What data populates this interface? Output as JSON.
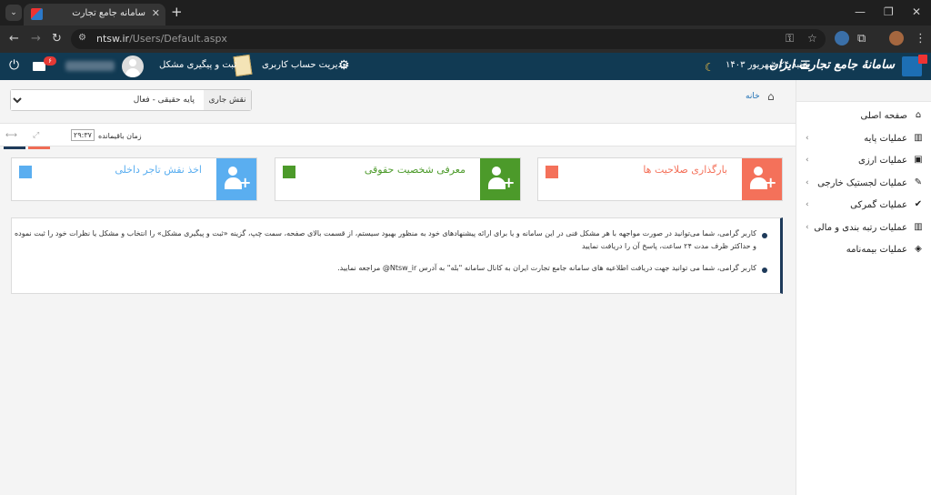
{
  "browser": {
    "tab_title": "سامانه جامع تجارت",
    "url_host": "ntsw.ir",
    "url_path": "/Users/Default.aspx"
  },
  "header": {
    "logo_text": "سامانهٔ جامع تجارت ایران",
    "date": "شنبه ۲۴ شهریور ۱۴۰۳",
    "account_mgmt": "مدیریت حساب کاربری",
    "issue_tracking": "ثبت و پیگیری مشکل",
    "notification_count": "۶"
  },
  "sidebar": {
    "items": [
      {
        "label": "صفحه اصلی",
        "icon": "home-icon",
        "glyph": "⌂",
        "has_submenu": false
      },
      {
        "label": "عملیات پایه",
        "icon": "bar-chart-icon",
        "glyph": "▥",
        "has_submenu": true
      },
      {
        "label": "عملیات ارزی",
        "icon": "money-icon",
        "glyph": "▣",
        "has_submenu": true
      },
      {
        "label": "عملیات لجستیک خارجی",
        "icon": "edit-icon",
        "glyph": "✎",
        "has_submenu": true
      },
      {
        "label": "عملیات گمرکی",
        "icon": "check-icon",
        "glyph": "✔",
        "has_submenu": true
      },
      {
        "label": "عملیات رتبه بندی و مالی",
        "icon": "bar-chart-icon",
        "glyph": "▥",
        "has_submenu": true
      },
      {
        "label": "عملیات بیمه‌نامه",
        "icon": "shield-icon",
        "glyph": "◈",
        "has_submenu": false
      }
    ]
  },
  "breadcrumb": {
    "home": "خانه"
  },
  "role": {
    "label": "نقش جاری",
    "selected": "پایه حقیقی - فعال"
  },
  "timer": {
    "label": "زمان باقیمانده",
    "value": "۲۹:۳۷"
  },
  "cards": [
    {
      "title": "بارگذاری صلاحیت ها",
      "color": "#f4715a"
    },
    {
      "title": "معرفی شخصیت حقوقی",
      "color": "#4c9a2a"
    },
    {
      "title": "اخذ نقش تاجر داخلی",
      "color": "#5aaef0"
    }
  ],
  "notices": [
    "کاربر گرامی، شما می‌توانید در صورت مواجهه با هر مشکل فنی در این سامانه و یا برای ارائه پیشنهادهای خود به منظور بهبود سیستم، از قسمت بالای صفحه، سمت چپ، گزینه «ثبت و پیگیری مشکل» را انتخاب و مشکل یا نظرات خود را ثبت نموده و حداکثر ظرف مدت ۲۴ ساعت، پاسخ آن را دریافت نمایید",
    "کاربر گرامی، شما می توانید جهت دریافت اطلاعیه های سامانه جامع تجارت ایران به کانال سامانه \"بله\" به آدرس Ntsw_ir@ مراجعه نمایید."
  ]
}
